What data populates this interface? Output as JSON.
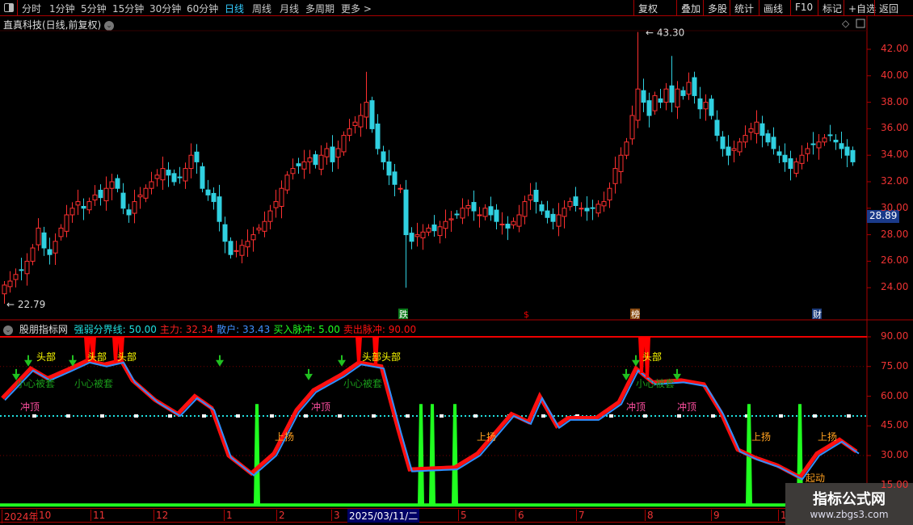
{
  "toolbar": {
    "periods": [
      "分时",
      "1分钟",
      "5分钟",
      "15分钟",
      "30分钟",
      "60分钟",
      "日线",
      "周线",
      "月线",
      "多周期",
      "更多 >"
    ],
    "active_period": "日线",
    "right_buttons": [
      "复权",
      "叠加",
      "多股",
      "统计",
      "画线",
      "F10",
      "标记",
      "+自选",
      "返回"
    ]
  },
  "main": {
    "title": "直真科技(日线,前复权)",
    "current_price": "28.89",
    "high_label": "43.30",
    "low_label": "22.79",
    "price_axis": [
      "42.00",
      "40.00",
      "38.00",
      "36.00",
      "34.00",
      "32.00",
      "30.00",
      "28.00",
      "26.00",
      "24.00"
    ],
    "event_markers": [
      {
        "label": "跌",
        "color": "#0a7a1a"
      },
      {
        "label": "$",
        "color": "#e00"
      },
      {
        "label": "榜",
        "color": "#8a4a10"
      },
      {
        "label": "财",
        "color": "#1a3a7a"
      }
    ]
  },
  "chart_data": [
    {
      "type": "candlestick",
      "ylim": [
        22,
        43.5
      ],
      "high": 43.3,
      "low": 22.79,
      "closes": [
        24.2,
        24.5,
        25,
        25.3,
        26,
        27,
        28.5,
        27,
        26.5,
        27.5,
        28.5,
        29.5,
        30,
        30.5,
        30,
        30.5,
        31,
        30.8,
        31.5,
        32,
        31.5,
        30,
        29.5,
        30.5,
        31,
        31.5,
        32,
        32.5,
        33,
        32.5,
        32,
        32.3,
        33,
        34,
        33.5,
        31.5,
        31,
        30.5,
        29,
        27.5,
        26.5,
        26.8,
        27.2,
        27.5,
        28,
        28.5,
        29,
        29.8,
        30.5,
        31.5,
        32.5,
        33,
        33.2,
        33.5,
        33.8,
        33.3,
        34,
        34.5,
        33.5,
        34.5,
        35.5,
        36,
        36.5,
        37,
        38,
        36,
        34.5,
        33.5,
        32.5,
        31.8,
        31.5,
        28,
        27.5,
        28,
        28.2,
        28.5,
        28.3,
        28.6,
        29,
        29.2,
        29.5,
        30,
        30.2,
        29.8,
        29.5,
        30,
        29.5,
        29,
        28.8,
        28.5,
        29,
        29.5,
        30.5,
        31,
        30.5,
        29.8,
        29.3,
        29,
        29.5,
        30,
        30.5,
        30.2,
        30,
        29.8,
        30,
        30.3,
        30.5,
        31.5,
        33,
        34,
        35,
        37,
        39,
        38,
        37,
        38.5,
        38,
        39,
        38,
        39,
        38.5,
        39.5,
        38.5,
        37.5,
        38,
        37,
        35.5,
        34.5,
        34,
        34.5,
        35,
        35.5,
        36,
        36.5,
        35.5,
        35,
        34.5,
        34,
        33.5,
        33,
        33.5,
        34,
        34.5,
        34.8,
        35,
        35.3,
        35.5,
        35,
        34.5,
        34,
        33.5
      ],
      "up_color": "#ff3030",
      "down_color": "#30d0e0"
    },
    {
      "type": "line",
      "ylim": [
        0,
        95
      ],
      "series": [
        {
          "name": "主力",
          "color": "#ff1010",
          "points": [
            [
              0,
              59
            ],
            [
              5,
              74
            ],
            [
              8,
              69
            ],
            [
              12,
              74
            ],
            [
              15,
              78
            ],
            [
              18,
              76
            ],
            [
              21,
              78
            ],
            [
              23,
              68
            ],
            [
              27,
              58
            ],
            [
              31,
              51
            ],
            [
              34,
              60
            ],
            [
              37,
              54
            ],
            [
              40,
              30
            ],
            [
              44,
              21
            ],
            [
              48,
              31
            ],
            [
              52,
              53
            ],
            [
              55,
              63
            ],
            [
              60,
              71
            ],
            [
              63,
              77
            ],
            [
              67,
              75
            ],
            [
              70,
              43
            ],
            [
              72,
              23
            ],
            [
              80,
              24
            ],
            [
              84,
              31
            ],
            [
              90,
              51
            ],
            [
              93,
              47
            ],
            [
              95,
              60
            ],
            [
              98,
              45
            ],
            [
              100,
              49
            ],
            [
              105,
              49
            ],
            [
              109,
              57
            ],
            [
              112,
              74
            ],
            [
              115,
              67
            ],
            [
              120,
              68
            ],
            [
              124,
              66
            ],
            [
              127,
              52
            ],
            [
              130,
              33
            ],
            [
              133,
              29
            ],
            [
              137,
              25
            ],
            [
              141,
              19
            ],
            [
              144,
              31
            ],
            [
              148,
              38
            ],
            [
              151,
              32
            ]
          ]
        },
        {
          "name": "散户",
          "color": "#3090ff",
          "offset": -1.5
        }
      ],
      "buy_pulse": {
        "name": "买入脉冲",
        "color": "#20ff20",
        "base": 5,
        "peak": 56,
        "at": [
          45,
          74,
          76,
          80,
          132,
          141
        ]
      },
      "sell_pulse": {
        "name": "卖出脉冲",
        "color": "#ff0000",
        "level": 90,
        "at": [
          15,
          16,
          20,
          21,
          63,
          66,
          113,
          114
        ]
      },
      "boundary": {
        "name": "强弱分界线",
        "value": 50,
        "color": "#20e0e0"
      },
      "axis": [
        "90.00",
        "75.00",
        "60.00",
        "45.00",
        "30.00",
        "15.00"
      ]
    }
  ],
  "indicator": {
    "name": "股朋指标网",
    "fields": [
      {
        "label": "强弱分界线: 50.00",
        "color": "#20e0e0"
      },
      {
        "label": "主力: 32.34",
        "color": "#ff2020"
      },
      {
        "label": "散户: 33.43",
        "color": "#4090ff"
      },
      {
        "label": "买入脉冲: 5.00",
        "color": "#20ff20"
      },
      {
        "label": "卖出脉冲: 90.00",
        "color": "#ff1010"
      }
    ],
    "annotations": {
      "top": "头部",
      "trap": "小心被套",
      "peak": "冲顶",
      "rise": "上扬",
      "start": "起动"
    }
  },
  "date_axis": {
    "labels": [
      "2024年",
      "10",
      "11",
      "12",
      "1",
      "2",
      "3",
      "5",
      "6",
      "7",
      "8",
      "9",
      "1"
    ],
    "cursor_date": "2025/03/11/二"
  },
  "watermark": {
    "name": "指标公式网",
    "url": "www.zbgs3.com"
  }
}
